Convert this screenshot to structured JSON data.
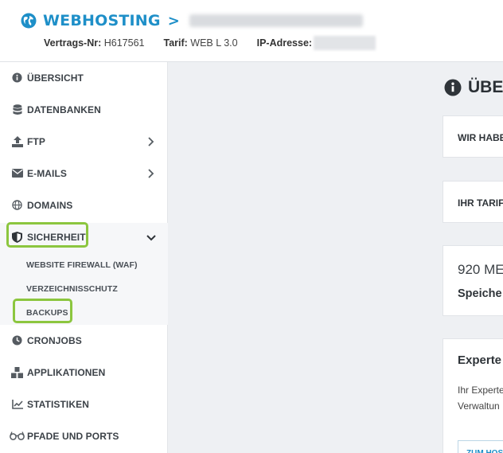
{
  "header": {
    "brand": "WEBHOSTING",
    "vertrag_label": "Vertrags-Nr:",
    "vertrag_value": "H617561",
    "tarif_label": "Tarif:",
    "tarif_value": "WEB L 3.0",
    "ip_label": "IP-Adresse:"
  },
  "sidebar": {
    "items": [
      {
        "label": "ÜBERSICHT",
        "icon": "info-icon"
      },
      {
        "label": "DATENBANKEN",
        "icon": "database-icon"
      },
      {
        "label": "FTP",
        "icon": "upload-icon"
      },
      {
        "label": "E-MAILS",
        "icon": "envelope-icon"
      },
      {
        "label": "DOMAINS",
        "icon": "globe-icon"
      },
      {
        "label": "SICHERHEIT",
        "icon": "shield-icon"
      },
      {
        "label": "CRONJOBS",
        "icon": "clock-icon"
      },
      {
        "label": "APPLIKATIONEN",
        "icon": "cubes-icon"
      },
      {
        "label": "STATISTIKEN",
        "icon": "chart-line-icon"
      },
      {
        "label": "PFADE UND PORTS",
        "icon": "glasses-icon"
      }
    ],
    "sub_items": [
      "WEBSITE FIREWALL (WAF)",
      "VERZEICHNISSCHUTZ",
      "BACKUPS"
    ]
  },
  "main": {
    "title": "ÜBER",
    "card1": "WIR HABE",
    "card2": "IHR TARIF",
    "card3_big": "920 ME",
    "card3_bold": "Speiche",
    "card4_head": "Experte",
    "card4_line1": "Ihr Experte",
    "card4_line2": "Verwaltun",
    "card4_button": "ZUM HOS"
  },
  "colors": {
    "brand": "#1e8fc8",
    "highlight": "#8cc63f"
  }
}
